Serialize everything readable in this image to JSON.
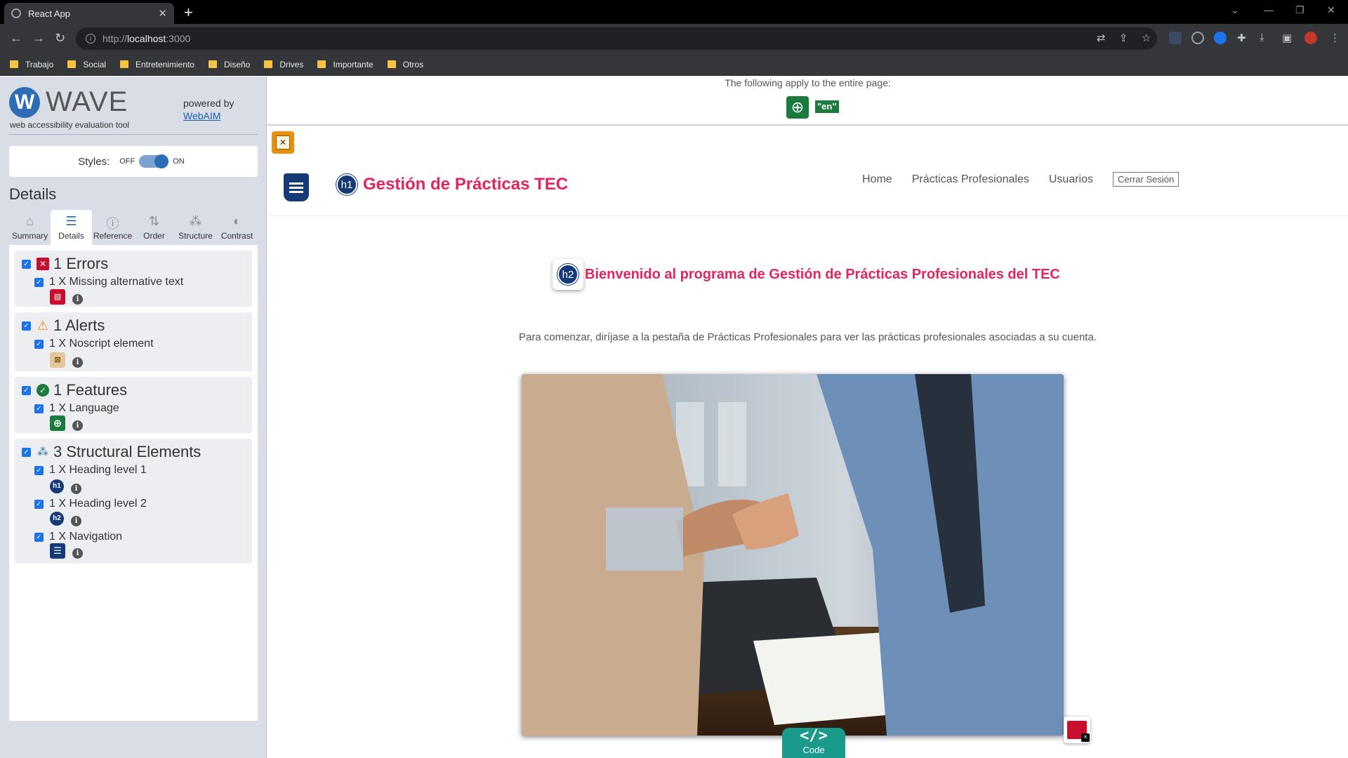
{
  "browser": {
    "tab_title": "React App",
    "url_scheme": "http://",
    "url_host": "localhost",
    "url_port": ":3000",
    "bookmarks": [
      "Trabajo",
      "Social",
      "Entretenimiento",
      "Diseño",
      "Drives",
      "Importante",
      "Otros"
    ]
  },
  "wave": {
    "name": "WAVE",
    "tagline": "web accessibility evaluation tool",
    "powered_by": "powered by",
    "webaim": "WebAIM",
    "styles_label": "Styles:",
    "styles_off": "OFF",
    "styles_on": "ON",
    "styles_enabled": true,
    "details_title": "Details",
    "tabs": [
      "Summary",
      "Details",
      "Reference",
      "Order",
      "Structure",
      "Contrast"
    ],
    "active_tab": "Details",
    "groups": {
      "errors": {
        "title": "1 Errors",
        "items": [
          "1 X Missing alternative text"
        ]
      },
      "alerts": {
        "title": "1 Alerts",
        "items": [
          "1 X Noscript element"
        ]
      },
      "features": {
        "title": "1 Features",
        "items": [
          "1 X Language"
        ]
      },
      "structure": {
        "title": "3 Structural Elements",
        "items": [
          "1 X Heading level 1",
          "1 X Heading level 2",
          "1 X Navigation"
        ]
      }
    }
  },
  "page": {
    "apply_text": "The following apply to the entire page:",
    "lang_badge": "\"en\"",
    "h1_badge": "h1",
    "h2_badge": "h2",
    "title": "Gestión de Prácticas TEC",
    "nav": [
      "Home",
      "Prácticas Profesionales",
      "Usuarios"
    ],
    "logout": "Cerrar Sesión",
    "welcome": "Bienvenido al programa de Gestión de Prácticas Profesionales del TEC",
    "intro": "Para comenzar, diríjase a la pestaña de Prácticas Profesionales para ver las prácticas profesionales asociadas a su cuenta.",
    "code_symbol": "</>",
    "code_label": "Code"
  },
  "colors": {
    "accent_pink": "#e0265f",
    "wave_blue": "#2d6db5",
    "error_red": "#c8102e",
    "alert_orange": "#e8900c",
    "feature_green": "#1b7b3d",
    "structure_navy": "#163a78",
    "code_teal": "#1a9a8a"
  }
}
